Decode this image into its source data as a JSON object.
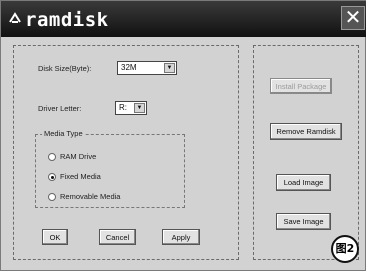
{
  "window": {
    "title": "ramdisk",
    "close_glyph": "✕"
  },
  "settings": {
    "disk_size_label": "Disk Size(Byte):",
    "disk_size_value": "32M",
    "drive_letter_label": "Driver Letter:",
    "drive_letter_value": "R:"
  },
  "media_type": {
    "title": "Media Type",
    "options": [
      {
        "label": "RAM Drive",
        "selected": false
      },
      {
        "label": "Fixed Media",
        "selected": true
      },
      {
        "label": "Removable Media",
        "selected": false
      }
    ]
  },
  "buttons": {
    "ok": "OK",
    "cancel": "Cancel",
    "apply": "Apply",
    "install": "Install Package",
    "remove": "Remove Ramdisk",
    "load": "Load Image",
    "save": "Save Image"
  },
  "badge": "图2"
}
